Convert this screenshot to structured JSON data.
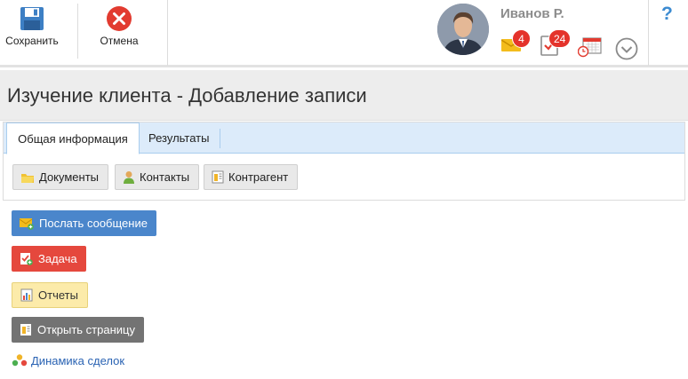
{
  "toolbar": {
    "save_label": "Сохранить",
    "cancel_label": "Отмена"
  },
  "user": {
    "name": "Иванов Р.",
    "messages_count": "4",
    "tasks_count": "24"
  },
  "help": {
    "label": "?"
  },
  "page": {
    "title": "Изучение клиента - Добавление записи"
  },
  "tabs": [
    {
      "label": "Общая информация",
      "active": true
    },
    {
      "label": "Результаты",
      "active": false
    }
  ],
  "section_buttons": [
    {
      "label": "Документы"
    },
    {
      "label": "Контакты"
    },
    {
      "label": "Контрагент"
    }
  ],
  "actions": [
    {
      "label": "Послать сообщение",
      "color": "#4a86cb"
    },
    {
      "label": "Задача",
      "color": "#e5483d"
    },
    {
      "label": "Отчеты",
      "color": "#fcebaa"
    },
    {
      "label": "Открыть страницу",
      "color": "#737373"
    }
  ],
  "link": {
    "label": "Динамика сделок"
  }
}
